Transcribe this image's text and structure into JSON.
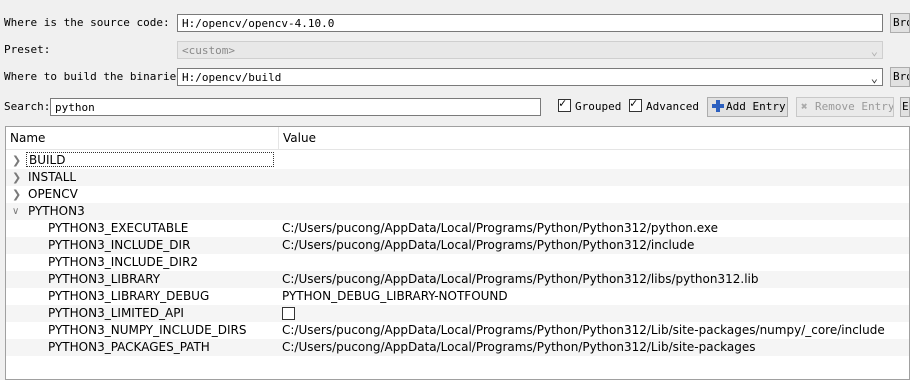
{
  "source": {
    "label": "Where is the source code:",
    "value": "H:/opencv/opencv-4.10.0",
    "browse_label": "Bro"
  },
  "preset": {
    "label": "Preset:",
    "value": "<custom>"
  },
  "build": {
    "label": "Where to build the binaries:",
    "value": "H:/opencv/build",
    "browse_label": "Bro"
  },
  "toolbar": {
    "search_label": "Search:",
    "search_value": "python",
    "grouped_label": "Grouped",
    "advanced_label": "Advanced",
    "add_entry_label": "Add Entry",
    "remove_entry_label": "Remove Entry",
    "extra_label": "E"
  },
  "table": {
    "col_name": "Name",
    "col_value": "Value",
    "groups": [
      {
        "name": "BUILD",
        "expanded": false
      },
      {
        "name": "INSTALL",
        "expanded": false
      },
      {
        "name": "OPENCV",
        "expanded": false
      },
      {
        "name": "PYTHON3",
        "expanded": true
      }
    ],
    "entries": [
      {
        "name": "PYTHON3_EXECUTABLE",
        "value": "C:/Users/pucong/AppData/Local/Programs/Python/Python312/python.exe"
      },
      {
        "name": "PYTHON3_INCLUDE_DIR",
        "value": "C:/Users/pucong/AppData/Local/Programs/Python/Python312/include"
      },
      {
        "name": "PYTHON3_INCLUDE_DIR2",
        "value": ""
      },
      {
        "name": "PYTHON3_LIBRARY",
        "value": "C:/Users/pucong/AppData/Local/Programs/Python/Python312/libs/python312.lib"
      },
      {
        "name": "PYTHON3_LIBRARY_DEBUG",
        "value": "PYTHON_DEBUG_LIBRARY-NOTFOUND"
      },
      {
        "name": "PYTHON3_LIMITED_API",
        "value": ""
      },
      {
        "name": "PYTHON3_NUMPY_INCLUDE_DIRS",
        "value": "C:/Users/pucong/AppData/Local/Programs/Python/Python312/Lib/site-packages/numpy/_core/include"
      },
      {
        "name": "PYTHON3_PACKAGES_PATH",
        "value": "C:/Users/pucong/AppData/Local/Programs/Python/Python312/Lib/site-packages"
      }
    ]
  }
}
